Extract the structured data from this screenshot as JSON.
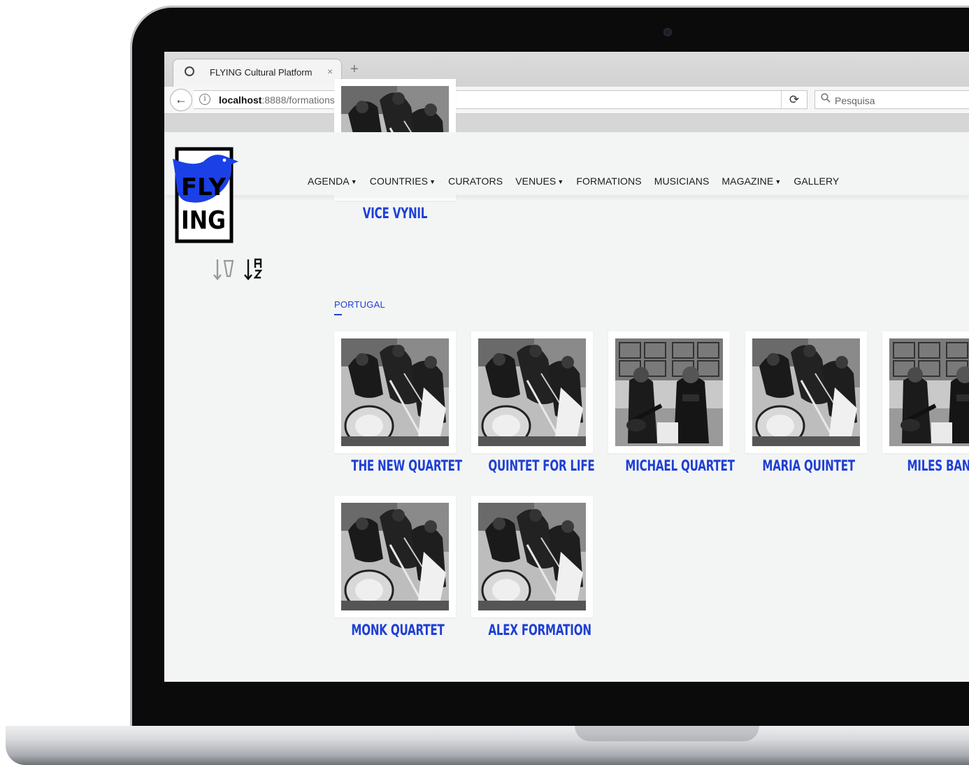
{
  "browser": {
    "tab_title": "FLYING Cultural Platform",
    "tab_close": "×",
    "new_tab": "+",
    "back": "←",
    "info": "i",
    "url_host": "localhost",
    "url_path": ":8888/formations/",
    "reload": "⟳",
    "search_placeholder": "Pesquisa"
  },
  "site": {
    "logo_line1": "FLY",
    "logo_line2": "ING",
    "nav": [
      {
        "label": "AGENDA",
        "caret": true
      },
      {
        "label": "COUNTRIES",
        "caret": true
      },
      {
        "label": "CURATORS",
        "caret": false
      },
      {
        "label": "VENUES",
        "caret": true
      },
      {
        "label": "FORMATIONS",
        "caret": false
      },
      {
        "label": "MUSICIANS",
        "caret": false
      },
      {
        "label": "MAGAZINE",
        "caret": true
      },
      {
        "label": "GALLERY",
        "caret": false
      }
    ],
    "caret_glyph": "▼",
    "sort_icons": [
      "sort-by-location-icon",
      "sort-alphabetical-icon"
    ]
  },
  "previous_group": {
    "cards": [
      {
        "title": "VICE VYNIL",
        "image": "jazz-band-photo"
      }
    ]
  },
  "group": {
    "country": "PORTUGAL",
    "cards": [
      {
        "title": "THE NEW QUARTET",
        "image": "jazz-band-photo"
      },
      {
        "title": "QUINTET FOR LIFE",
        "image": "jazz-band-photo"
      },
      {
        "title": "MICHAEL QUARTET",
        "image": "duo-musicians-photo"
      },
      {
        "title": "MARIA QUINTET",
        "image": "jazz-band-photo"
      },
      {
        "title": "MILES BAND",
        "image": "duo-musicians-photo"
      },
      {
        "title": "MONK QUARTET",
        "image": "jazz-band-photo"
      },
      {
        "title": "ALEX FORMATION",
        "image": "jazz-band-photo"
      }
    ]
  },
  "colors": {
    "accent": "#1e3fd6",
    "logo_blue": "#1a40e6",
    "page_bg": "#f3f5f4"
  }
}
